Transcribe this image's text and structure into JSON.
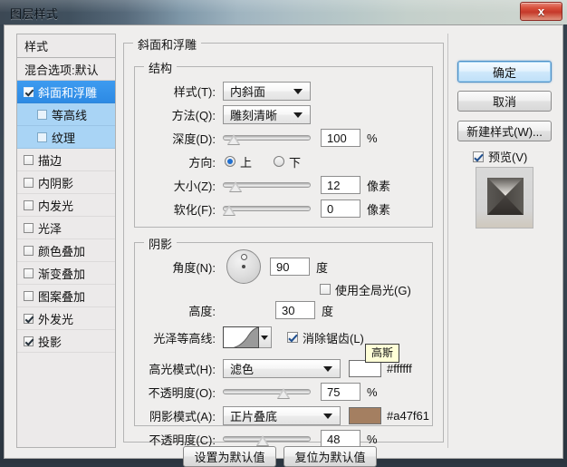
{
  "window": {
    "title": "图层样式",
    "close_label": "x"
  },
  "styles_panel": {
    "header": "样式",
    "blending_options": "混合选项:默认",
    "items": [
      {
        "label": "斜面和浮雕",
        "checked": true,
        "selected": true,
        "sub": false
      },
      {
        "label": "等高线",
        "checked": false,
        "selected": false,
        "sub": true
      },
      {
        "label": "纹理",
        "checked": false,
        "selected": false,
        "sub": true
      },
      {
        "label": "描边",
        "checked": false,
        "selected": false,
        "sub": false
      },
      {
        "label": "内阴影",
        "checked": false,
        "selected": false,
        "sub": false
      },
      {
        "label": "内发光",
        "checked": false,
        "selected": false,
        "sub": false
      },
      {
        "label": "光泽",
        "checked": false,
        "selected": false,
        "sub": false
      },
      {
        "label": "颜色叠加",
        "checked": false,
        "selected": false,
        "sub": false
      },
      {
        "label": "渐变叠加",
        "checked": false,
        "selected": false,
        "sub": false
      },
      {
        "label": "图案叠加",
        "checked": false,
        "selected": false,
        "sub": false
      },
      {
        "label": "外发光",
        "checked": true,
        "selected": false,
        "sub": false
      },
      {
        "label": "投影",
        "checked": true,
        "selected": false,
        "sub": false
      }
    ]
  },
  "main": {
    "section_title": "斜面和浮雕",
    "structure": {
      "legend": "结构",
      "style": {
        "label": "样式(T):",
        "value": "内斜面"
      },
      "technique": {
        "label": "方法(Q):",
        "value": "雕刻清晰"
      },
      "depth": {
        "label": "深度(D):",
        "value": "100",
        "unit": "%",
        "percent": 6
      },
      "direction": {
        "label": "方向:",
        "up_label": "上",
        "down_label": "下",
        "selected": "up"
      },
      "size": {
        "label": "大小(Z):",
        "value": "12",
        "unit": "像素",
        "percent": 8
      },
      "soften": {
        "label": "软化(F):",
        "value": "0",
        "unit": "像素",
        "percent": 0
      }
    },
    "shading": {
      "legend": "阴影",
      "angle": {
        "label": "角度(N):",
        "value": "90",
        "unit": "度"
      },
      "use_global_light": {
        "label": "使用全局光(G)",
        "checked": false
      },
      "altitude": {
        "label": "高度:",
        "value": "30",
        "unit": "度"
      },
      "gloss_contour": {
        "label": "光泽等高线:",
        "tooltip": "高斯"
      },
      "anti_alias": {
        "label": "消除锯齿(L)",
        "checked": true
      },
      "highlight_mode": {
        "label": "高光模式(H):",
        "value": "滤色",
        "color": "#ffffff",
        "hex_label": "#ffffff"
      },
      "highlight_opacity": {
        "label": "不透明度(O):",
        "value": "75",
        "unit": "%",
        "percent": 72
      },
      "shadow_mode": {
        "label": "阴影模式(A):",
        "value": "正片叠底",
        "color": "#a47f61",
        "hex_label": "#a47f61"
      },
      "shadow_opacity": {
        "label": "不透明度(C):",
        "value": "48",
        "unit": "%",
        "percent": 44
      }
    },
    "set_default_label": "设置为默认值",
    "reset_default_label": "复位为默认值"
  },
  "right_panel": {
    "ok_label": "确定",
    "cancel_label": "取消",
    "new_style_label": "新建样式(W)...",
    "preview": {
      "label": "预览(V)",
      "checked": true
    }
  }
}
